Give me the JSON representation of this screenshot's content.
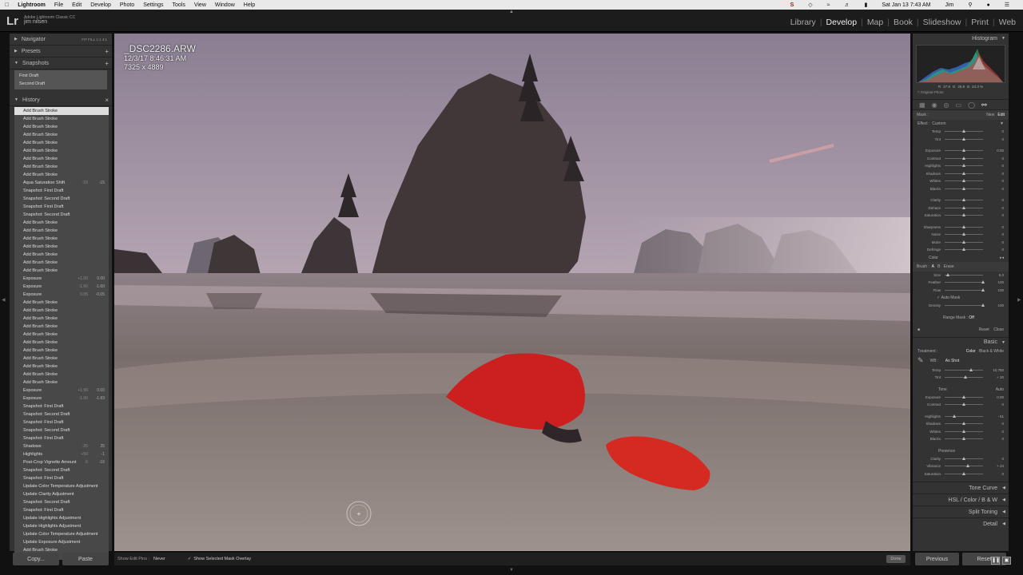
{
  "menubar": {
    "app": "Lightroom",
    "items": [
      "File",
      "Edit",
      "Develop",
      "Photo",
      "Settings",
      "Tools",
      "View",
      "Window",
      "Help"
    ],
    "date_time": "Sat Jan 13  7:43 AM",
    "user": "Jim"
  },
  "identity": {
    "product": "Adobe Lightroom Classic CC",
    "user": "jim nilsen"
  },
  "modules": [
    "Library",
    "Develop",
    "Map",
    "Book",
    "Slideshow",
    "Print",
    "Web"
  ],
  "active_module": "Develop",
  "left": {
    "navigator": "Navigator",
    "nav_opts": "FIT   FILL   1:1   4:1",
    "presets": "Presets",
    "snapshots": "Snapshots",
    "snapshot_items": [
      "First Draft",
      "Second Draft"
    ],
    "history": "History",
    "history_items": [
      {
        "label": "Add Brush Stroke"
      },
      {
        "label": "Add Brush Stroke"
      },
      {
        "label": "Add Brush Stroke"
      },
      {
        "label": "Add Brush Stroke"
      },
      {
        "label": "Add Brush Stroke"
      },
      {
        "label": "Add Brush Stroke"
      },
      {
        "label": "Add Brush Stroke"
      },
      {
        "label": "Add Brush Stroke"
      },
      {
        "label": "Add Brush Stroke"
      },
      {
        "label": "Aqua Saturation Shift",
        "b": "-15",
        "a": "-15"
      },
      {
        "label": "Snapshot: First Draft"
      },
      {
        "label": "Snapshot: Second Draft"
      },
      {
        "label": "Snapshot: First Draft"
      },
      {
        "label": "Snapshot: Second Draft"
      },
      {
        "label": "Add Brush Stroke"
      },
      {
        "label": "Add Brush Stroke"
      },
      {
        "label": "Add Brush Stroke"
      },
      {
        "label": "Add Brush Stroke"
      },
      {
        "label": "Add Brush Stroke"
      },
      {
        "label": "Add Brush Stroke"
      },
      {
        "label": "Add Brush Stroke"
      },
      {
        "label": "Exposure",
        "b": "+1.00",
        "a": "0.00"
      },
      {
        "label": "Exposure",
        "b": "-1.60",
        "a": "-1.60"
      },
      {
        "label": "Exposure",
        "b": "0.05",
        "a": "-0.05"
      },
      {
        "label": "Add Brush Stroke"
      },
      {
        "label": "Add Brush Stroke"
      },
      {
        "label": "Add Brush Stroke"
      },
      {
        "label": "Add Brush Stroke"
      },
      {
        "label": "Add Brush Stroke"
      },
      {
        "label": "Add Brush Stroke"
      },
      {
        "label": "Add Brush Stroke"
      },
      {
        "label": "Add Brush Stroke"
      },
      {
        "label": "Add Brush Stroke"
      },
      {
        "label": "Add Brush Stroke"
      },
      {
        "label": "Add Brush Stroke"
      },
      {
        "label": "Exposure",
        "b": "+1.90",
        "a": "0.00"
      },
      {
        "label": "Exposure",
        "b": "-1.90",
        "a": "-1.83"
      },
      {
        "label": "Snapshot: First Draft"
      },
      {
        "label": "Snapshot: Second Draft"
      },
      {
        "label": "Snapshot: First Draft"
      },
      {
        "label": "Snapshot: Second Draft"
      },
      {
        "label": "Snapshot: First Draft"
      },
      {
        "label": "Shadows",
        "b": "-25",
        "a": "25"
      },
      {
        "label": "Highlights",
        "b": "+50",
        "a": "-1"
      },
      {
        "label": "Post-Crop Vignette Amount",
        "b": "-5",
        "a": "-16"
      },
      {
        "label": "Snapshot: Second Draft"
      },
      {
        "label": "Snapshot: First Draft"
      },
      {
        "label": "Update Color Temperature Adjustment"
      },
      {
        "label": "Update Clarity Adjustment"
      },
      {
        "label": "Snapshot: Second Draft"
      },
      {
        "label": "Snapshot: First Draft"
      },
      {
        "label": "Update Highlights Adjustment"
      },
      {
        "label": "Update Highlights Adjustment"
      },
      {
        "label": "Update Color Temperature Adjustment"
      },
      {
        "label": "Update Exposure Adjustment"
      },
      {
        "label": "Add Brush Stroke"
      }
    ],
    "copy": "Copy...",
    "paste": "Paste"
  },
  "photo": {
    "name": "_DSC2286.ARW",
    "datetime": "12/3/17 8:46:31 AM",
    "dims": "7325 x 4889"
  },
  "toolbar": {
    "show_pins_label": "Show Edit Pins :",
    "show_pins_value": "Never",
    "mask_overlay": "Show Selected Mask Overlay",
    "done": "Done"
  },
  "right": {
    "histogram": "Histogram",
    "hist_vals": [
      "R",
      "27.9",
      "G",
      "25.9",
      "B",
      "24.3 %"
    ],
    "original": "Original Photo",
    "mask_label": "Mask :",
    "mask_new": "New",
    "mask_edit": "Edit",
    "effect_label": "Effect :",
    "effect_value": "Custom",
    "brush_rows1": [
      {
        "label": "Temp",
        "value": "0",
        "pos": 0.5
      },
      {
        "label": "Tint",
        "value": "0",
        "pos": 0.5
      }
    ],
    "brush_rows2": [
      {
        "label": "Exposure",
        "value": "0.00",
        "pos": 0.5
      },
      {
        "label": "Contrast",
        "value": "0",
        "pos": 0.5
      },
      {
        "label": "Highlights",
        "value": "0",
        "pos": 0.5
      },
      {
        "label": "Shadows",
        "value": "0",
        "pos": 0.5
      },
      {
        "label": "Whites",
        "value": "0",
        "pos": 0.5
      },
      {
        "label": "Blacks",
        "value": "0",
        "pos": 0.5
      }
    ],
    "brush_rows3": [
      {
        "label": "Clarity",
        "value": "0",
        "pos": 0.5
      },
      {
        "label": "Dehaze",
        "value": "0",
        "pos": 0.5
      },
      {
        "label": "Saturation",
        "value": "0",
        "pos": 0.5
      }
    ],
    "brush_rows4": [
      {
        "label": "Sharpness",
        "value": "0",
        "pos": 0.5
      },
      {
        "label": "Noise",
        "value": "0",
        "pos": 0.5
      },
      {
        "label": "Moire",
        "value": "0",
        "pos": 0.5
      },
      {
        "label": "Defringe",
        "value": "0",
        "pos": 0.5
      }
    ],
    "color_label": "Color",
    "brush_label": "Brush :",
    "brush_a": "A",
    "brush_b": "B",
    "brush_erase": "Erase",
    "brush_rows5": [
      {
        "label": "Size",
        "value": "5.0",
        "pos": 0.1
      },
      {
        "label": "Feather",
        "value": "100",
        "pos": 1.0
      },
      {
        "label": "Flow",
        "value": "100",
        "pos": 1.0
      }
    ],
    "auto_mask": "Auto Mask",
    "density": {
      "label": "Density",
      "value": "100",
      "pos": 1.0
    },
    "range_mask_label": "Range Mask :",
    "range_mask_value": "Off",
    "reset": "Reset",
    "close": "Close",
    "basic": "Basic",
    "treatment_label": "Treatment :",
    "treatment_color": "Color",
    "treatment_bw": "Black & White",
    "wb_label": "WB :",
    "wb_value": "As Shot",
    "wb_rows": [
      {
        "label": "Temp",
        "value": "10,750",
        "pos": 0.7
      },
      {
        "label": "Tint",
        "value": "+ 20",
        "pos": 0.55
      }
    ],
    "tone_label": "Tone",
    "tone_auto": "Auto",
    "tone_rows1": [
      {
        "label": "Exposure",
        "value": "0.00",
        "pos": 0.5
      },
      {
        "label": "Contrast",
        "value": "0",
        "pos": 0.5
      }
    ],
    "tone_rows2": [
      {
        "label": "Highlights",
        "value": "- 51",
        "pos": 0.25
      },
      {
        "label": "Shadows",
        "value": "0",
        "pos": 0.5
      },
      {
        "label": "Whites",
        "value": "0",
        "pos": 0.5
      },
      {
        "label": "Blacks",
        "value": "0",
        "pos": 0.5
      }
    ],
    "presence_label": "Presence",
    "presence_rows": [
      {
        "label": "Clarity",
        "value": "0",
        "pos": 0.5
      },
      {
        "label": "Vibrance",
        "value": "+ 24",
        "pos": 0.62
      },
      {
        "label": "Saturation",
        "value": "0",
        "pos": 0.5
      }
    ],
    "tone_curve": "Tone Curve",
    "hsl": "HSL  /  Color  /  B & W",
    "split_toning": "Split Toning",
    "detail": "Detail",
    "previous": "Previous",
    "reset_btn": "Reset"
  }
}
